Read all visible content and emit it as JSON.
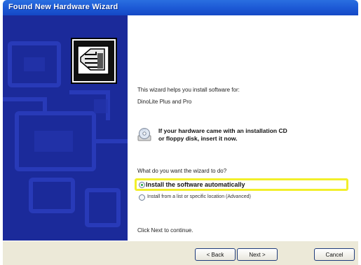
{
  "window": {
    "title": "Found New Hardware Wizard"
  },
  "content": {
    "intro": "This wizard helps you install software for:",
    "device": "DinoLite Plus and Pro",
    "cd_notice_line1": "If your hardware came with an installation CD",
    "cd_notice_line2": "or floppy disk, insert it now.",
    "question": "What do you want the wizard to do?",
    "option_auto": "Install the software automatically",
    "option_manual": "Install from a list or specific location (Advanced)",
    "continue_text": "Click Next to continue."
  },
  "buttons": {
    "back": "< Back",
    "next": "Next >",
    "cancel": "Cancel"
  },
  "colors": {
    "side_panel": "#1b2a9a",
    "highlight": "#f2ef2a",
    "titlebar": "#1d5ad6"
  },
  "icons": {
    "hardware": "hardware-device-icon",
    "cd": "cd-disk-icon"
  }
}
